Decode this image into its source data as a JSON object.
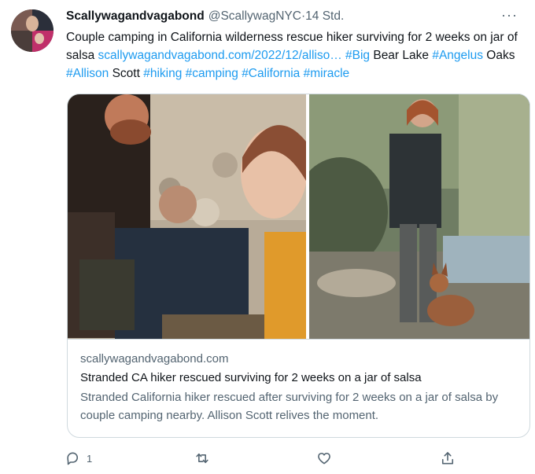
{
  "tweet": {
    "author_name": "Scallywagandvagabond",
    "author_handle": "@ScallywagNYC",
    "separator": " · ",
    "time": "14 Std.",
    "text_1": "Couple camping in California wilderness rescue hiker surviving for 2 weeks on jar of salsa ",
    "url": "scallywagandvagabond.com/2022/12/alliso…",
    "tag_big": "#Big",
    "text_bear": " Bear Lake ",
    "tag_angelus": "#Angelus",
    "text_oaks": " Oaks ",
    "tag_allison": "#Allison",
    "text_scott": " Scott ",
    "tag_hiking": "#hiking",
    "tag_camping": "#camping",
    "tag_california": "#California",
    "tag_miracle": "#miracle",
    "space": " "
  },
  "card": {
    "domain": "scallywagandvagabond.com",
    "title": "Stranded CA hiker rescued surviving for 2 weeks on a jar of salsa",
    "description": "Stranded California hiker rescued after surviving for 2 weeks on a jar of salsa by couple camping nearby. Allison Scott relives the moment."
  },
  "actions": {
    "reply_count": "1",
    "reply_icon": "reply-icon",
    "retweet_icon": "retweet-icon",
    "like_icon": "heart-icon",
    "share_icon": "share-icon"
  },
  "colors": {
    "link": "#1d9bf0",
    "secondary_text": "#536471",
    "primary_text": "#0f1419",
    "border": "#cfd9de"
  }
}
